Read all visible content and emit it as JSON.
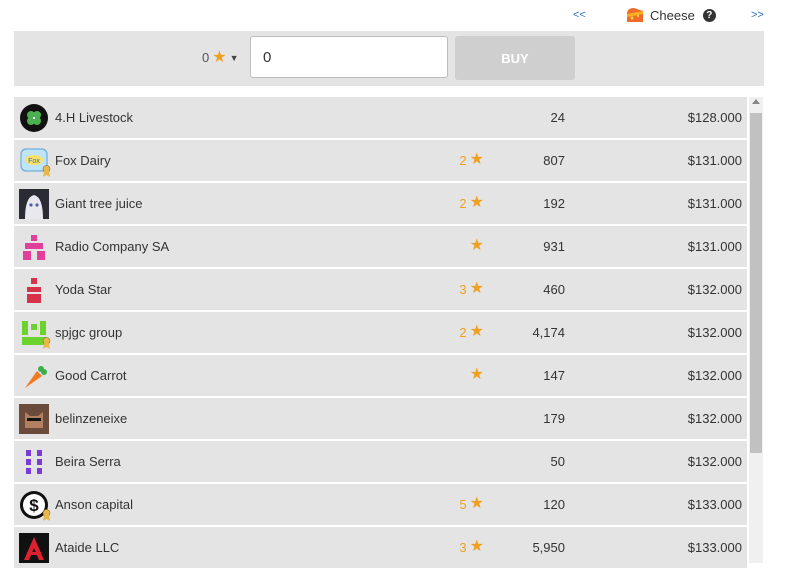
{
  "nav": {
    "prev_label": "<<",
    "next_label": ">>"
  },
  "resource": {
    "name": "Cheese",
    "help": "?"
  },
  "buybar": {
    "quality_value": "0",
    "quantity_value": "0",
    "buy_label": "BUY"
  },
  "accent_color": "#f0a020",
  "rows": [
    {
      "name": "4.H Livestock",
      "quality": "",
      "has_star": false,
      "quantity": "24",
      "price": "$128.000",
      "icon": "clover-logo",
      "badge": false
    },
    {
      "name": "Fox Dairy",
      "quality": "2",
      "has_star": true,
      "quantity": "807",
      "price": "$131.000",
      "icon": "fox-dairy-logo",
      "badge": true
    },
    {
      "name": "Giant tree juice",
      "quality": "2",
      "has_star": true,
      "quantity": "192",
      "price": "$131.000",
      "icon": "anime-avatar-logo",
      "badge": false
    },
    {
      "name": "Radio Company SA",
      "quality": "",
      "has_star": true,
      "quantity": "931",
      "price": "$131.000",
      "icon": "pink-blocks-logo",
      "badge": false
    },
    {
      "name": "Yoda Star",
      "quality": "3",
      "has_star": true,
      "quantity": "460",
      "price": "$132.000",
      "icon": "red-blocks-logo",
      "badge": false
    },
    {
      "name": "spjgc group",
      "quality": "2",
      "has_star": true,
      "quantity": "4,174",
      "price": "$132.000",
      "icon": "green-blocks-logo",
      "badge": true
    },
    {
      "name": "Good Carrot",
      "quality": "",
      "has_star": true,
      "quantity": "147",
      "price": "$132.000",
      "icon": "carrot-logo",
      "badge": false
    },
    {
      "name": "belinzeneixe",
      "quality": "",
      "has_star": false,
      "quantity": "179",
      "price": "$132.000",
      "icon": "cat-photo-logo",
      "badge": false
    },
    {
      "name": "Beira Serra",
      "quality": "",
      "has_star": false,
      "quantity": "50",
      "price": "$132.000",
      "icon": "purple-blocks-logo",
      "badge": false
    },
    {
      "name": "Anson capital",
      "quality": "5",
      "has_star": true,
      "quantity": "120",
      "price": "$133.000",
      "icon": "dollar-logo",
      "badge": true
    },
    {
      "name": "Ataide LLC",
      "quality": "3",
      "has_star": true,
      "quantity": "5,950",
      "price": "$133.000",
      "icon": "red-a-logo",
      "badge": false
    }
  ]
}
